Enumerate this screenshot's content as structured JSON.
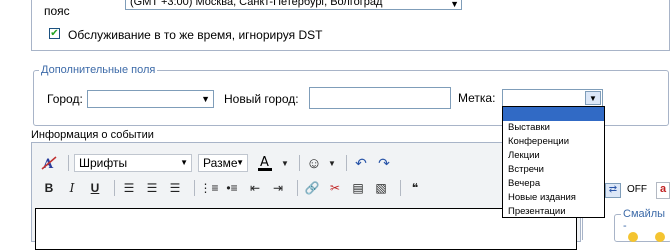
{
  "timezone": {
    "label": "пояс",
    "selected": "(GMT +3:00) Москва, Санкт-Петербург, Волгоград"
  },
  "dst": {
    "checked": true,
    "label": "Обслуживание в то же время, игнорируя DST"
  },
  "extra": {
    "legend": "Дополнительные поля",
    "city_label": "Город:",
    "new_city_label": "Новый город:",
    "tag_label": "Метка:",
    "tag_options": [
      "Выставки",
      "Конференции",
      "Лекции",
      "Встречи",
      "Вечера",
      "Новые издания",
      "Презентации"
    ]
  },
  "editor": {
    "section_title": "Информация о событии",
    "font_label": "Шрифты",
    "size_label": "Разме",
    "toggle_label": "OFF"
  },
  "smiles": {
    "legend": "Смайлы -"
  }
}
